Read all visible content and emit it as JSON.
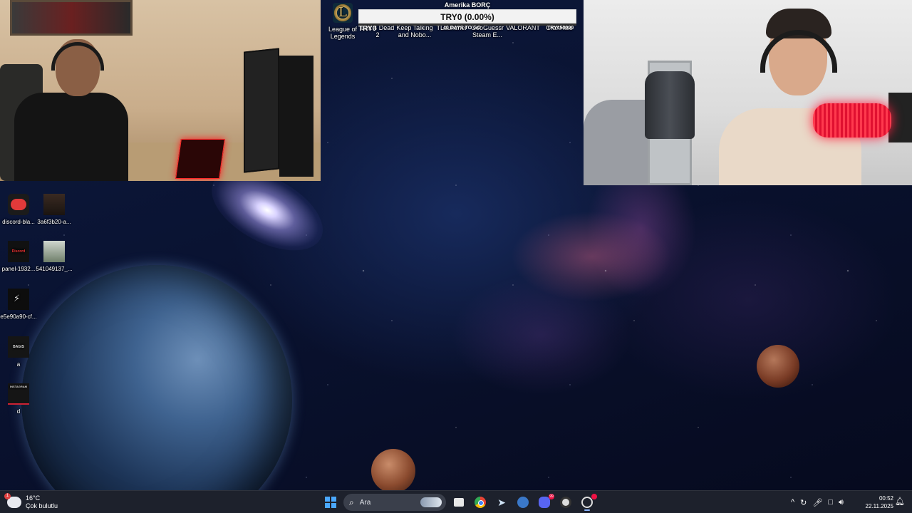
{
  "top_launcher": {
    "icons": [
      {
        "label_line1": "League of",
        "label_line2": "Legends",
        "icon": "league-of-legends-icon",
        "glyph": "L"
      },
      {
        "label_line1": "Left 4 Dead 2",
        "label_line2": "",
        "icon": "left4dead2-icon"
      },
      {
        "label_line1": "Keep Talking",
        "label_line2": "and Nobo...",
        "icon": "keep-talking-icon"
      },
      {
        "label_line1": "TLauncher",
        "label_line2": "",
        "icon": "tlauncher-icon"
      },
      {
        "label_line1": "GeoGuessr",
        "label_line2": "Steam E...",
        "icon": "geoguessr-icon"
      },
      {
        "label_line1": "VALORANT",
        "label_line2": "",
        "icon": "valorant-icon"
      },
      {
        "label_line1": "CraftRise",
        "label_line2": "",
        "icon": "craftrise-icon"
      }
    ]
  },
  "debt_tracker": {
    "title": "Amerika BORÇ",
    "amount": "TRY0 (0.00%)",
    "progress_percent": 0,
    "left_label": "TRY0",
    "center_label": "40 DAYS TO GO",
    "right_label": "TRY450000",
    "fill_color": "#39c15a"
  },
  "desktop_icons": [
    {
      "label": "discord-bla...",
      "thumb": "discord-thumb"
    },
    {
      "label": "3a6f3b20-a...",
      "thumb": "photo-thumb"
    },
    {
      "label": "panel-1932...",
      "thumb": "panel-thumb",
      "thumb_text": "Discord"
    },
    {
      "label": "541049137_...",
      "thumb": "person-thumb"
    },
    {
      "label": "e5e90a90-cf...",
      "thumb": "dark-thumb"
    },
    {
      "label": "a",
      "thumb": "bagis-thumb",
      "thumb_text": "BAGIS"
    },
    {
      "label": "d",
      "thumb": "instagram-thumb",
      "thumb_text": "INSTAGRAM"
    }
  ],
  "taskbar": {
    "weather": {
      "temperature": "16°C",
      "condition": "Çok bulutlu",
      "badge": "1",
      "icon": "cloud-icon"
    },
    "search": {
      "placeholder": "Ara",
      "icon": "search-icon"
    },
    "pinned": [
      {
        "name": "task-view",
        "icon": "task-view-icon"
      },
      {
        "name": "chrome",
        "icon": "chrome-icon"
      },
      {
        "name": "steam",
        "icon": "steam-icon"
      },
      {
        "name": "app",
        "icon": "app-icon"
      },
      {
        "name": "discord",
        "icon": "discord-icon",
        "badge": "99"
      },
      {
        "name": "obs",
        "icon": "obs-icon"
      },
      {
        "name": "recorder",
        "icon": "recorder-icon"
      }
    ],
    "tray": {
      "chevron": "^",
      "time": "00:52",
      "date": "22.11.2025"
    },
    "accent_color": "#4aa8ff"
  }
}
